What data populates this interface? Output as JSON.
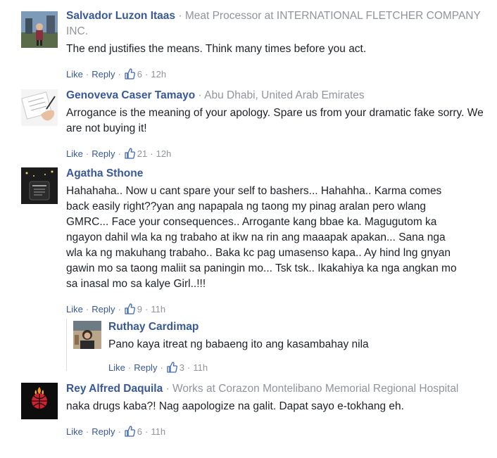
{
  "comments": [
    {
      "name": "Salvador Luzon Itaas",
      "meta": "Meat Processor at INTERNATIONAL FLETCHER COMPANY INC.",
      "text": "The end justifies the means. Think many times before you act.",
      "like": "Like",
      "reply": "Reply",
      "likes": "6",
      "time": "12h"
    },
    {
      "name": "Genoveva Caser Tamayo",
      "meta": "Abu Dhabi, United Arab Emirates",
      "text": "Arrogance is the meaning of your apology. Spare us from your dramatic fake sorry. We are not buying it!",
      "like": "Like",
      "reply": "Reply",
      "likes": "21",
      "time": "12h"
    },
    {
      "name": "Agatha Sthone",
      "meta": "",
      "text": "Hahahaha.. Now u cant spare your self to bashers... Hahahha.. Karma comes back easily right??yan ang napapala ng taong my pinag aralan pero wlang GMRC... Face your consequences.. Arrogante kang bbae ka. Magugutom ka ngayon dahil wla ka ng trabaho at ikw na rin ang maaapak apakan... Sana nga wla ka ng makuhang trabaho.. Baka kc pag umasenso kapa.. Ay hind lng gnyan gawin mo sa taong maliit sa paningin mo... Tsk tsk.. Ikakahiya ka nga angkan mo sa inasal mo sa kalye Girl..!!!",
      "like": "Like",
      "reply": "Reply",
      "likes": "9",
      "time": "11h",
      "reply_comment": {
        "name": "Ruthay Cardimap",
        "text": "Pano kaya itreat ng babaeng ito ang kasambahay nila",
        "like": "Like",
        "reply": "Reply",
        "likes": "3",
        "time": "11h"
      }
    },
    {
      "name": "Rey Alfred Daquila",
      "meta": "Works at Corazon Montelibano Memorial Regional Hospital",
      "text": "naka drugs kaba?! Nag aapologize na galit. Dapat sayo e-tokhang eh.",
      "like": "Like",
      "reply": "Reply",
      "likes": "6",
      "time": "11h"
    }
  ],
  "colors": {
    "name_link": "#385898",
    "meta_gray": "#90949c",
    "text": "#1d2129"
  },
  "icons": {
    "like_count": "thumbs-up-icon"
  }
}
